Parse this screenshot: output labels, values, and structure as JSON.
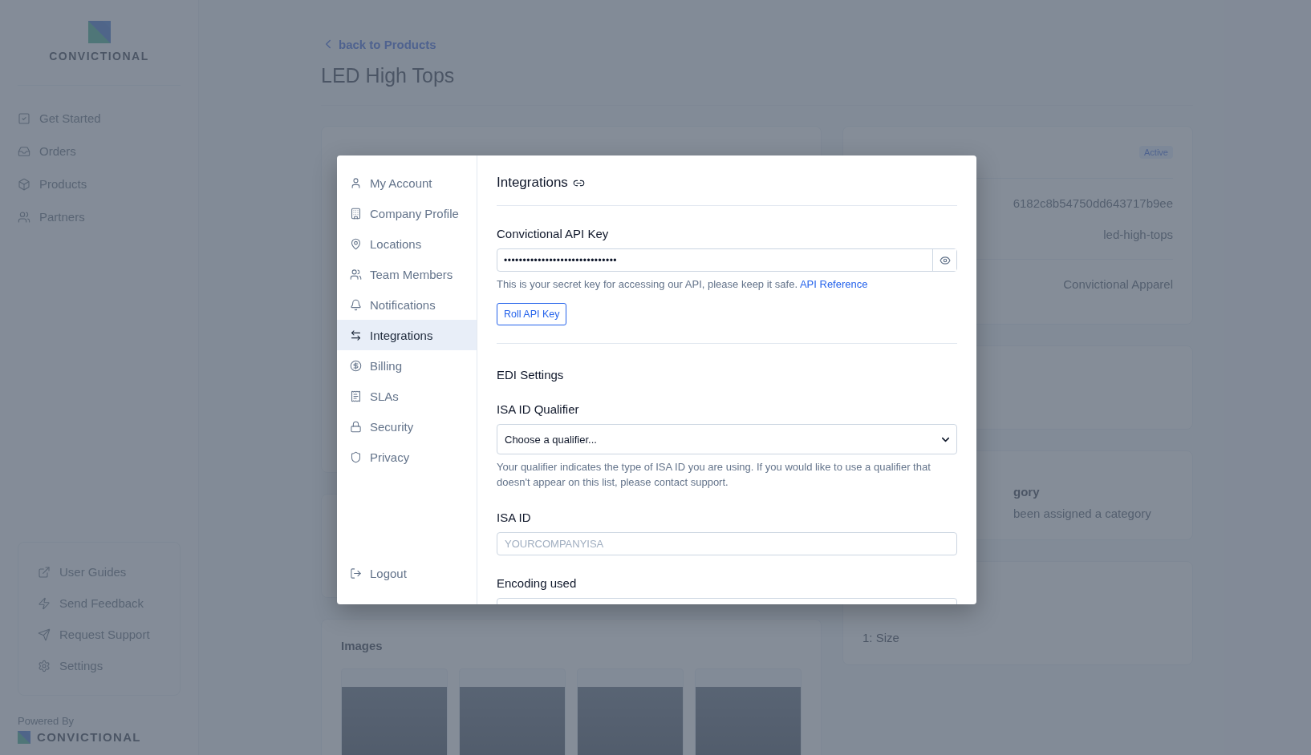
{
  "sidebar": {
    "brand": "CONVICTIONAL",
    "nav": [
      {
        "label": "Get Started"
      },
      {
        "label": "Orders"
      },
      {
        "label": "Products"
      },
      {
        "label": "Partners"
      }
    ],
    "help_links": [
      {
        "label": "User Guides"
      },
      {
        "label": "Send Feedback"
      },
      {
        "label": "Request Support"
      },
      {
        "label": "Settings"
      }
    ],
    "powered_by": "Powered By",
    "footer_brand": "CONVICTIONAL"
  },
  "page": {
    "back_link": "back to Products",
    "title": "LED High Tops"
  },
  "images_card": {
    "title": "Images",
    "images": [
      {
        "kind": "photo"
      },
      {
        "kind": "photo"
      },
      {
        "kind": "photo"
      },
      {
        "kind": "photo"
      }
    ]
  },
  "status_card": {
    "badge": "Active",
    "rows": [
      "6182c8b54750dd643717b9ee",
      "led-high-tops"
    ],
    "brand": "Convictional Apparel"
  },
  "category_card": {
    "title": "gory",
    "text": "been assigned a category"
  },
  "options_card": {
    "text": "1: Size"
  },
  "modal": {
    "nav": [
      {
        "label": "My Account",
        "selected": false
      },
      {
        "label": "Company Profile",
        "selected": false
      },
      {
        "label": "Locations",
        "selected": false
      },
      {
        "label": "Team Members",
        "selected": false
      },
      {
        "label": "Notifications",
        "selected": false
      },
      {
        "label": "Integrations",
        "selected": true
      },
      {
        "label": "Billing",
        "selected": false
      },
      {
        "label": "SLAs",
        "selected": false
      },
      {
        "label": "Security",
        "selected": false
      },
      {
        "label": "Privacy",
        "selected": false
      }
    ],
    "logout": "Logout",
    "title": "Integrations",
    "api_key": {
      "label": "Convictional API Key",
      "value": "••••••••••••••••••••••••••••••",
      "help": "This is your secret key for accessing our API, please keep it safe.",
      "link": "API Reference",
      "button": "Roll API Key"
    },
    "edi": {
      "title": "EDI Settings",
      "fields": [
        {
          "kind": "select",
          "label": "ISA ID Qualifier",
          "value": "Choose a qualifier...",
          "help": "Your qualifier indicates the type of ISA ID you are using. If you would like to use a qualifier that doesn't appear on this list, please contact support."
        },
        {
          "kind": "text",
          "label": "ISA ID",
          "placeholder": "YOURCOMPANYISA"
        },
        {
          "kind": "select",
          "label": "Encoding used"
        }
      ]
    }
  }
}
